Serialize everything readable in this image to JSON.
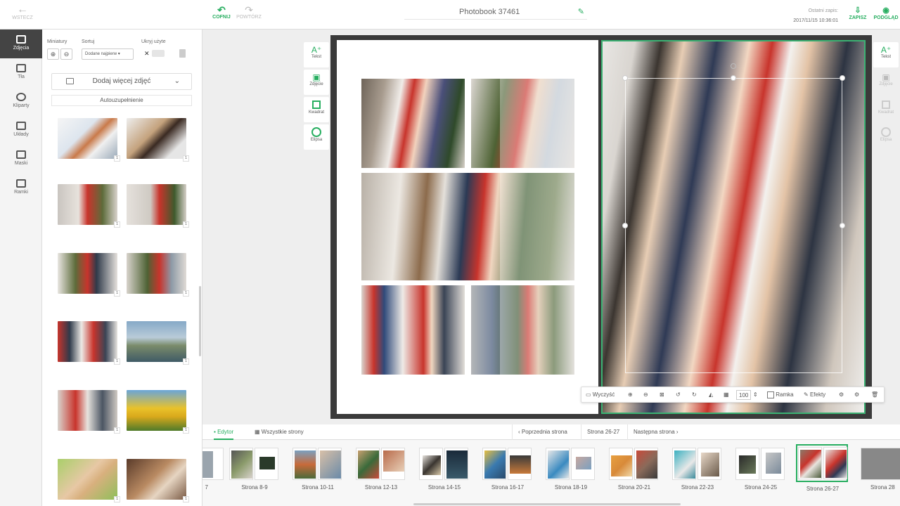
{
  "topbar": {
    "back_label": "WSTECZ",
    "undo_label": "COFNIJ",
    "redo_label": "POWTÓRZ",
    "title": "Photobook 37461",
    "last_save_label": "Ostatni zapis:",
    "last_save_time": "2017/11/15 10:36:01",
    "save_label": "ZAPISZ",
    "preview_label": "PODGLĄD"
  },
  "rail": [
    "Zdjęcia",
    "Tła",
    "Kliparty",
    "Układy",
    "Maski",
    "Ramki"
  ],
  "panel": {
    "thumbs_label": "Miniatury",
    "sort_label": "Sortuj",
    "sort_value": "Dodane najpierw",
    "hide_used_label": "Ukryj użyte",
    "add_more_label": "Dodaj więcej zdjęć",
    "autofill_label": "Autouzupełnienie",
    "thumb_badge": "1"
  },
  "tools_left": [
    "Tekst",
    "Zdjęcie",
    "Kwadrat",
    "Elipsa"
  ],
  "tools_right": [
    "Tekst",
    "Zdjęcie",
    "Kwadrat",
    "Elipsa"
  ],
  "image_toolbar": {
    "clear_label": "Wyczyść",
    "zoom_value": "100",
    "frame_label": "Ramka",
    "effects_label": "Efekty"
  },
  "bottom": {
    "editor_tab": "Edytor",
    "all_pages_tab": "Wszystkie strony",
    "prev_page": "Poprzednia strona",
    "current_page": "Strona 26-27",
    "next_page": "Następna strona"
  },
  "spreads": [
    "7",
    "Strona 8-9",
    "Strona 10-11",
    "Strona 12-13",
    "Strona 14-15",
    "Strona 16-17",
    "Strona 18-19",
    "Strona 20-21",
    "Strona 22-23",
    "Strona 24-25",
    "Strona 26-27",
    "Strona 28"
  ]
}
